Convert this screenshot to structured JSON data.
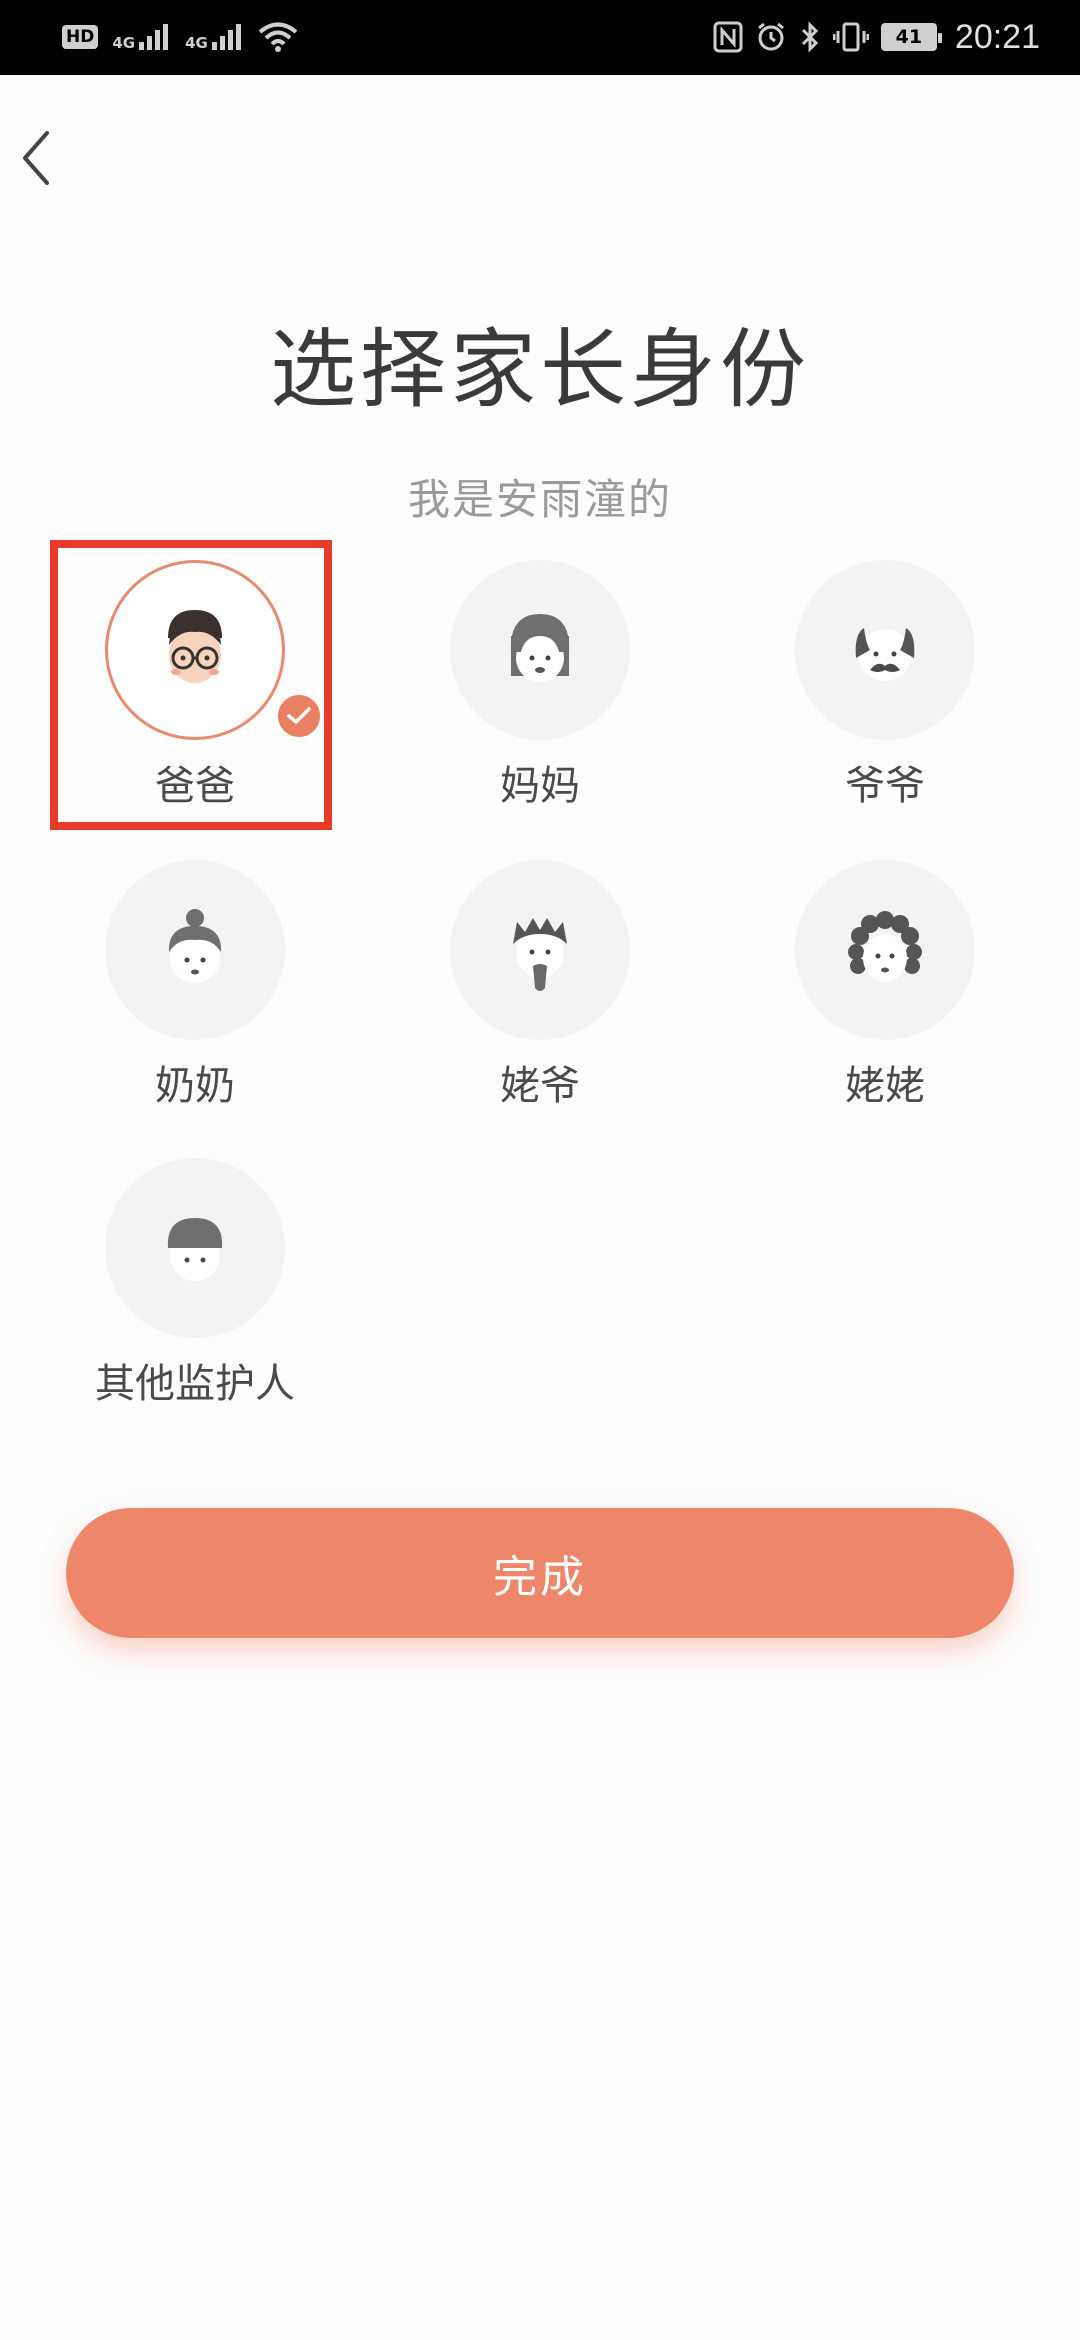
{
  "status_bar": {
    "left": {
      "hd": "HD",
      "net1": "4G",
      "net2": "4G"
    },
    "battery": "41",
    "time": "20:21"
  },
  "header": {
    "title": "选择家长身份",
    "subtitle": "我是安雨潼的"
  },
  "roles": [
    {
      "label": "爸爸",
      "icon": "father-avatar-icon",
      "selected": true
    },
    {
      "label": "妈妈",
      "icon": "mother-avatar-icon",
      "selected": false
    },
    {
      "label": "爷爷",
      "icon": "grandpa-avatar-icon",
      "selected": false
    },
    {
      "label": "奶奶",
      "icon": "grandma-avatar-icon",
      "selected": false
    },
    {
      "label": "姥爷",
      "icon": "maternal-grandpa-avatar-icon",
      "selected": false
    },
    {
      "label": "姥姥",
      "icon": "maternal-grandma-avatar-icon",
      "selected": false
    },
    {
      "label": "其他监护人",
      "icon": "other-guardian-avatar-icon",
      "selected": false
    }
  ],
  "done_button": {
    "label": "完成"
  },
  "colors": {
    "accent": "#ee866a",
    "highlight": "#e83b2a"
  }
}
